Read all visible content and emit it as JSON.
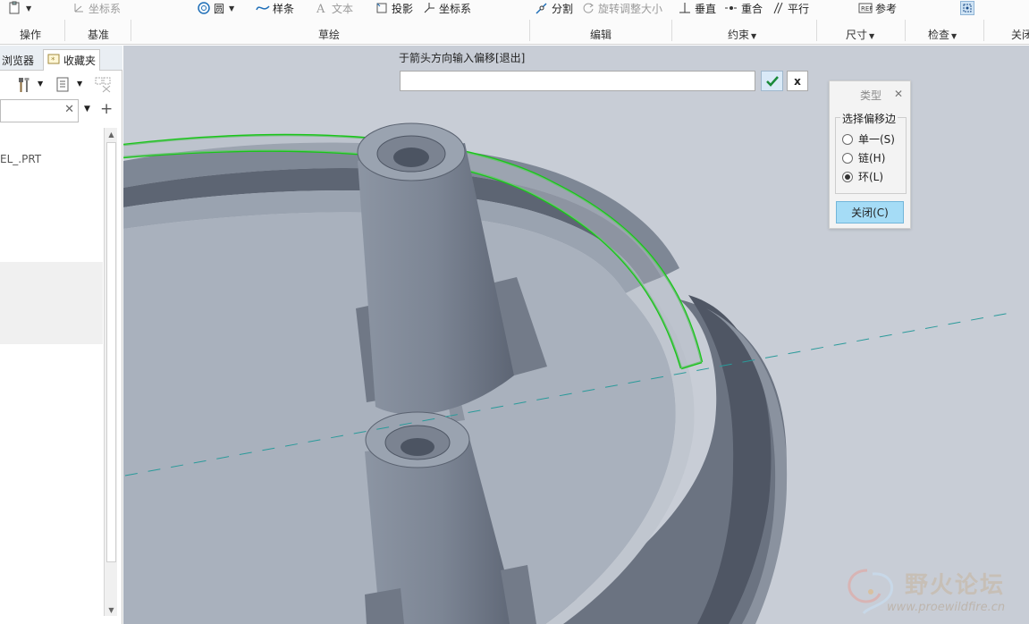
{
  "ribbon": {
    "items": {
      "operations_menu": "",
      "datum_csys": "坐标系",
      "circle": "圆",
      "spline": "样条",
      "text": "文本",
      "project": "投影",
      "csys": "坐标系",
      "divide": "分割",
      "rotate_resize": "旋转调整大小",
      "vertical": "垂直",
      "coincident": "重合",
      "parallel": "平行",
      "reference": "参考"
    },
    "groups": {
      "operations": "操作",
      "datum": "基准",
      "sketching": "草绘",
      "editing": "编辑",
      "constraints": "约束",
      "dimensions": "尺寸",
      "inspect": "检查",
      "close": "关闭"
    }
  },
  "left_panel": {
    "tabs": [
      "浏览器",
      "收藏夹"
    ],
    "filter_value": "",
    "tree_item": "EL_.PRT"
  },
  "prompt": {
    "message": "于箭头方向输入偏移[退出]",
    "input_value": ""
  },
  "type_dialog": {
    "title": "类型",
    "group_label": "选择偏移边",
    "options": [
      {
        "label": "单一(S)",
        "checked": false
      },
      {
        "label": "链(H)",
        "checked": false
      },
      {
        "label": "环(L)",
        "checked": true
      }
    ],
    "close_label": "关闭(C)"
  },
  "watermark": {
    "title": "野火论坛",
    "url": "www.proewildfire.cn"
  },
  "colors": {
    "selection_green": "#19c419",
    "model_grey": "#8d96a5",
    "centerline_teal": "#2a9a9a",
    "viewport_bg": "#c8cdd6",
    "button_accent": "#a5dcf6"
  }
}
